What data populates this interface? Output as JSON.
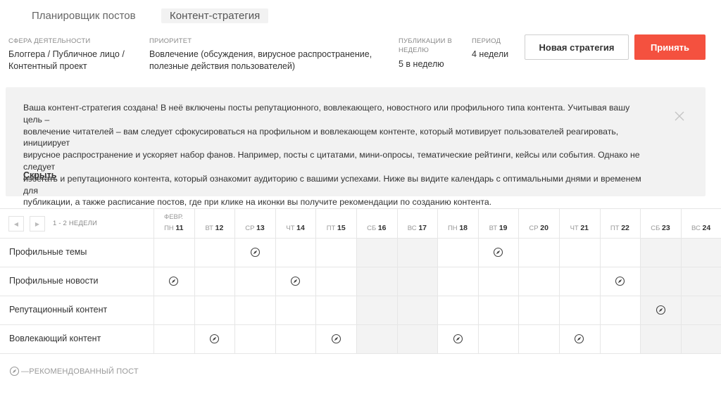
{
  "tabs": {
    "planner": "Планировщик постов",
    "strategy": "Контент-стратегия"
  },
  "meta": {
    "sphere": {
      "label": "СФЕРА ДЕЯТЕЛЬНОСТИ",
      "line1": "Блоггера / Публичное лицо /",
      "line2": "Контентный проект"
    },
    "priority": {
      "label": "ПРИОРИТЕТ",
      "line1": "Вовлечение (обсуждения, вирусное распространение,",
      "line2": "полезные действия пользователей)"
    },
    "per_week": {
      "label1": "ПУБЛИКАЦИИ В",
      "label2": "НЕДЕЛЮ",
      "value": "5 в неделю"
    },
    "period": {
      "label": "ПЕРИОД",
      "value": "4 недели"
    }
  },
  "buttons": {
    "new_strategy": "Новая стратегия",
    "accept": "Принять"
  },
  "info": {
    "lines": [
      "Ваша контент-стратегия создана!  В неё включены посты репутационного, вовлекающего, новостного или профильного типа контента. Учитывая вашу цель –",
      "вовлечение читателей – вам следует сфокусироваться на профильном и вовлекающем контенте, который мотивирует пользователей реагировать, инициирует",
      "вирусное распространение и ускоряет набор фанов. Например, посты с цитатами, мини-опросы, тематические рейтинги, кейсы или события. Однако не следует",
      "избегать и репутационного контента, который ознакомит аудиторию с вашими успехами. Ниже вы видите календарь с оптимальными днями и временем для",
      "публикации, а также расписание постов, где при клике на иконки вы получите рекомендации по созданию контента."
    ],
    "hide": "Скрыть"
  },
  "calendar": {
    "prev": "◀",
    "next": "▶",
    "range": "1 - 2 НЕДЕЛИ",
    "month": "ФЕВР.",
    "days": [
      {
        "dow": "ПН",
        "date": "11"
      },
      {
        "dow": "ВТ",
        "date": "12"
      },
      {
        "dow": "СР",
        "date": "13"
      },
      {
        "dow": "ЧТ",
        "date": "14"
      },
      {
        "dow": "ПТ",
        "date": "15"
      },
      {
        "dow": "СБ",
        "date": "16"
      },
      {
        "dow": "ВС",
        "date": "17"
      },
      {
        "dow": "ПН",
        "date": "18"
      },
      {
        "dow": "ВТ",
        "date": "19"
      },
      {
        "dow": "СР",
        "date": "20"
      },
      {
        "dow": "ЧТ",
        "date": "21"
      },
      {
        "dow": "ПТ",
        "date": "22"
      },
      {
        "dow": "СБ",
        "date": "23"
      },
      {
        "dow": "ВС",
        "date": "24"
      }
    ],
    "rows": [
      {
        "label": "Профильные темы",
        "posts": [
          "13",
          "19"
        ]
      },
      {
        "label": "Профильные новости",
        "posts": [
          "11",
          "14",
          "22"
        ]
      },
      {
        "label": "Репутационный контент",
        "posts": [
          "23"
        ]
      },
      {
        "label": "Вовлекающий контент",
        "posts": [
          "12",
          "15",
          "18",
          "21"
        ]
      }
    ]
  },
  "legend": "—РЕКОМЕНДОВАННЫЙ ПОСТ",
  "colors": {
    "accent": "#f4513f",
    "weekend_bg": "#f3f3f3",
    "info_bg": "#f2f2f2"
  },
  "icons": {
    "post": "compass-icon",
    "close": "close-icon"
  }
}
